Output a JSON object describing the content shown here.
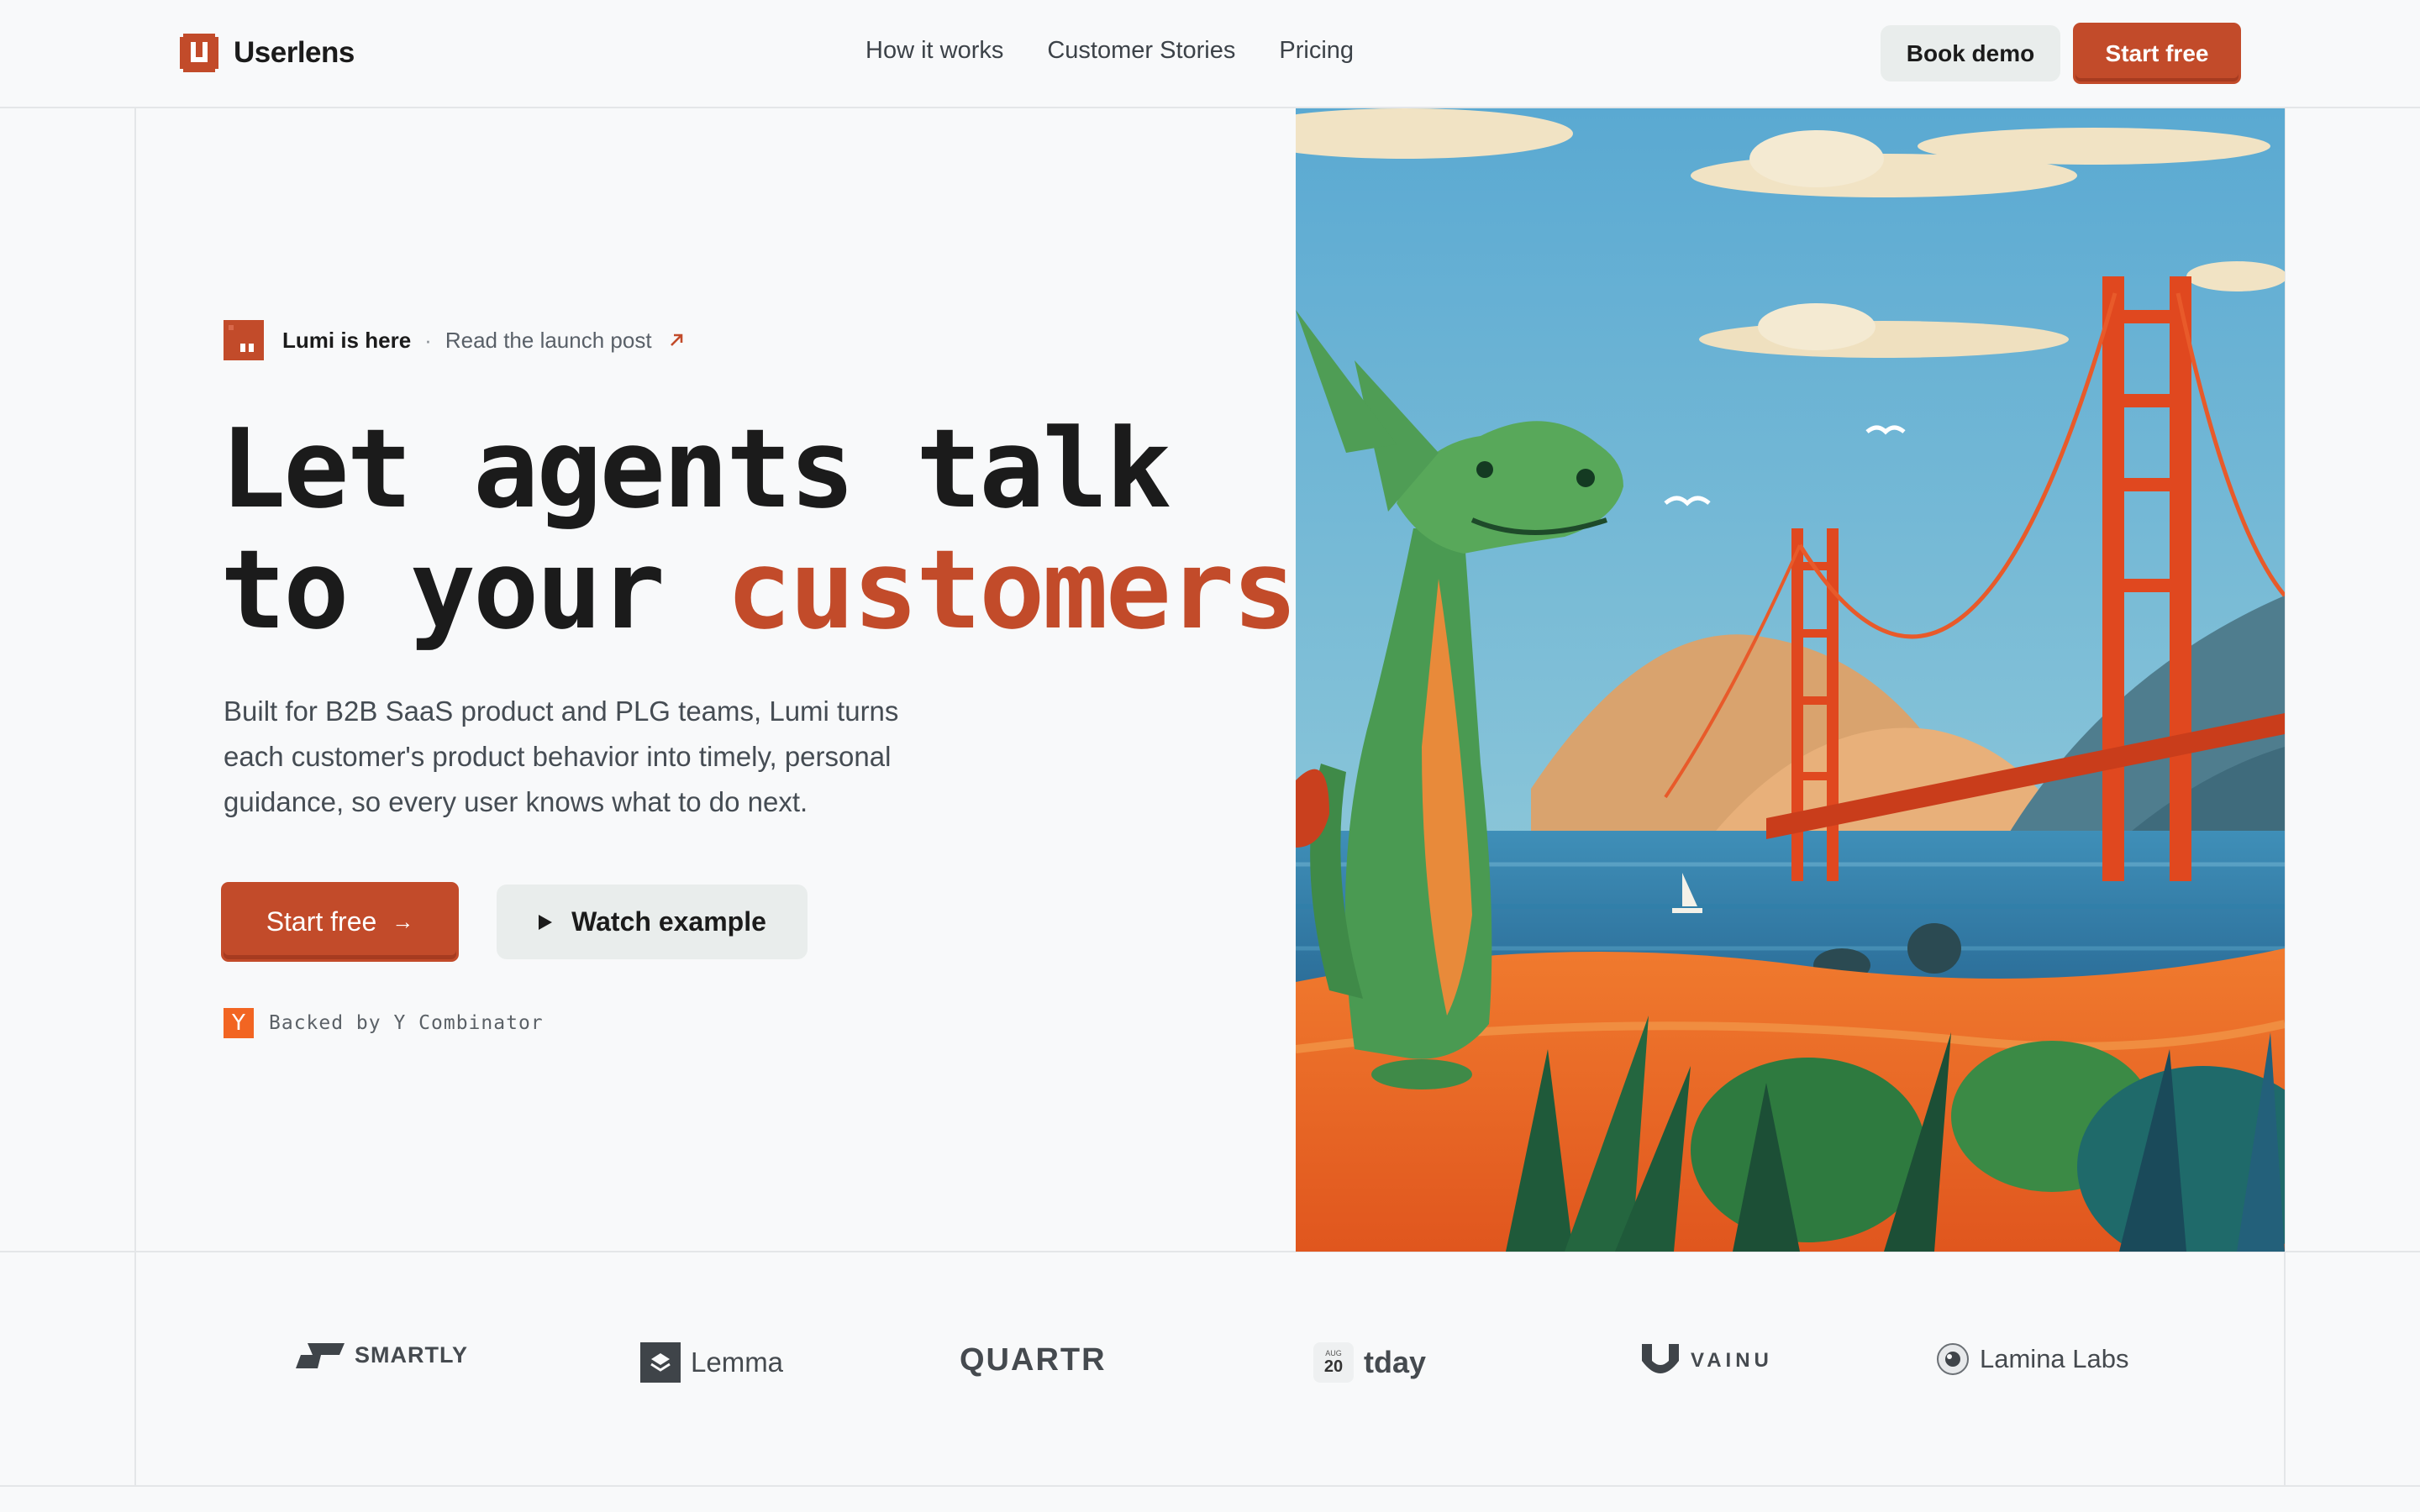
{
  "header": {
    "brand": "Userlens",
    "nav": [
      "How it works",
      "Customer Stories",
      "Pricing"
    ],
    "book_demo": "Book demo",
    "start_free": "Start free"
  },
  "hero": {
    "badge_strong": "Lumi is here",
    "badge_separator": "·",
    "badge_link": "Read the launch post",
    "headline_line1": "Let agents talk",
    "headline_line2_prefix": "to your ",
    "headline_accent": "customers.",
    "subtitle": "Built for B2B SaaS product and PLG teams, Lumi turns each customer's product behavior into timely, personal guidance, so every user knows what to do next.",
    "cta_primary": "Start free",
    "cta_primary_arrow": "→",
    "cta_secondary": "Watch example",
    "backed_icon": "Y",
    "backed_text": "Backed by Y Combinator"
  },
  "logos": {
    "smartly": "SMARTLY",
    "lemma": "Lemma",
    "quartr": "QUARTR",
    "tday_month": "AUG",
    "tday_day": "20",
    "tday": "tday",
    "vainu": "VAINU",
    "lamina": "Lamina Labs"
  },
  "colors": {
    "accent": "#c24b2a",
    "background": "#f8f9fa",
    "secondary_button": "#e9edec",
    "yc_orange": "#f26522"
  },
  "icons": [
    "userlens-logo-icon",
    "lumi-badge-icon",
    "arrow-up-right-icon",
    "arrow-right-icon",
    "play-icon",
    "y-combinator-icon"
  ]
}
